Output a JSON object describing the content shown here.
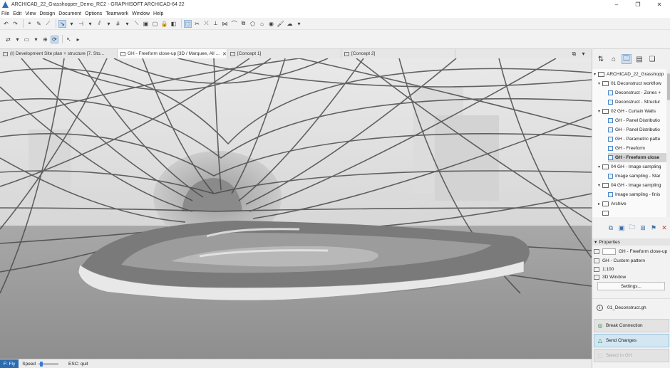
{
  "window": {
    "title": "ARCHICAD_22_Grasshopper_Demo_RC2 - GRAPHISOFT ARCHICAD-64 22",
    "minimize": "–",
    "maximize": "❐",
    "close": "✕"
  },
  "menu": [
    "File",
    "Edit",
    "View",
    "Design",
    "Document",
    "Options",
    "Teamwork",
    "Window",
    "Help"
  ],
  "tabs": [
    {
      "label": "(I) Development Site plan + structure [7. Sto...",
      "active": false,
      "closable": false
    },
    {
      "label": "GH - Freeform close-up [3D / Marquee, All ...",
      "active": true,
      "closable": true
    },
    {
      "label": "[Concept 1]",
      "active": false,
      "closable": false
    },
    {
      "label": "[Concept 2]",
      "active": false,
      "closable": false
    }
  ],
  "statusbar": {
    "mode": "F: Fly",
    "speed_label": "Speed",
    "hint": "ESC: quit"
  },
  "navigator": {
    "root": "ARCHICAD_22_Grasshopp",
    "items": [
      {
        "label": "01 Deconstruct workflow",
        "type": "folder"
      },
      {
        "label": "Deconstruct - Zones +",
        "type": "view"
      },
      {
        "label": "Deconstruct - Structur",
        "type": "view"
      },
      {
        "label": "02 GH - Curtain Walls",
        "type": "folder"
      },
      {
        "label": "GH - Panel Distributio",
        "type": "view"
      },
      {
        "label": "GH - Panel Distributio",
        "type": "view"
      },
      {
        "label": "GH - Parametric patte",
        "type": "view"
      },
      {
        "label": "GH - Freeform",
        "type": "view"
      },
      {
        "label": "GH - Freeform close",
        "type": "view",
        "selected": true
      },
      {
        "label": "04 GH - Image sampling",
        "type": "folder"
      },
      {
        "label": "Image sampling - Star",
        "type": "view"
      },
      {
        "label": "04 GH - Image sampling",
        "type": "folder"
      },
      {
        "label": "Image sampling - finis",
        "type": "view"
      },
      {
        "label": "Archive",
        "type": "folder"
      }
    ]
  },
  "properties": {
    "header": "Properties",
    "name": "GH - Freeform close-up",
    "pattern": "GH - Custom pattern",
    "scale": "1:100",
    "window": "3D Window",
    "settings": "Settings..."
  },
  "grasshopper": {
    "file": "01_Deconstruct.gh",
    "break": "Break Connection",
    "send": "Send Changes",
    "select": "Select in GH"
  },
  "colors": {
    "accent": "#2b6cb0",
    "selected_row": "#d4d4d4",
    "send_highlight": "#d3e7f3"
  }
}
